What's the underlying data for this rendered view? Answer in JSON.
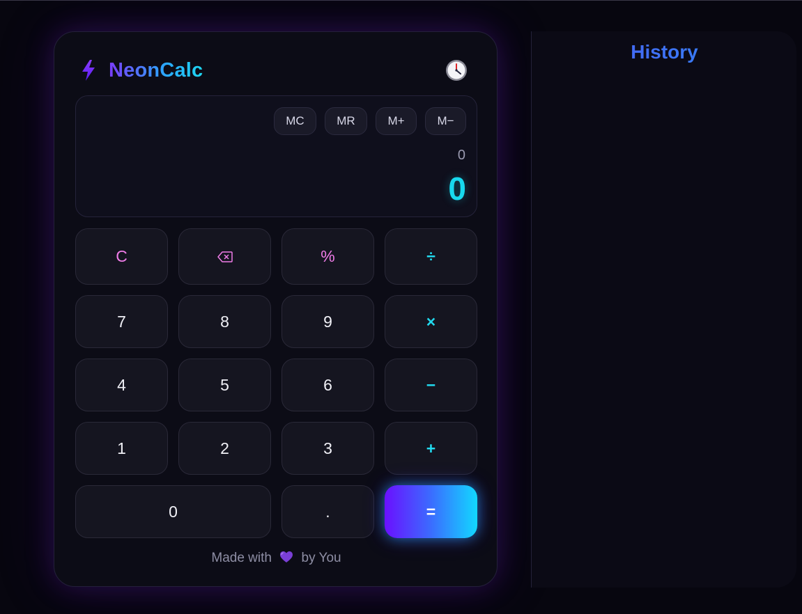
{
  "app": {
    "name": "NeonCalc",
    "history_toggle_icon": "clock-icon"
  },
  "display": {
    "memory_buttons": [
      "MC",
      "MR",
      "M+",
      "M−"
    ],
    "expression": "0",
    "result": "0"
  },
  "keypad": {
    "rows": [
      [
        "C",
        "⌫",
        "%",
        "÷"
      ],
      [
        "7",
        "8",
        "9",
        "×"
      ],
      [
        "4",
        "5",
        "6",
        "−"
      ],
      [
        "1",
        "2",
        "3",
        "+"
      ],
      [
        "0",
        ".",
        "="
      ]
    ]
  },
  "footer": {
    "prefix": "Made with",
    "icon": "purple-heart-icon",
    "suffix": "by You"
  },
  "history": {
    "title": "History",
    "entries": []
  },
  "colors": {
    "accent_cyan": "#18d9ee",
    "accent_purple": "#6a10ff",
    "function_pink": "#f07ce8",
    "background": "#07060f"
  }
}
